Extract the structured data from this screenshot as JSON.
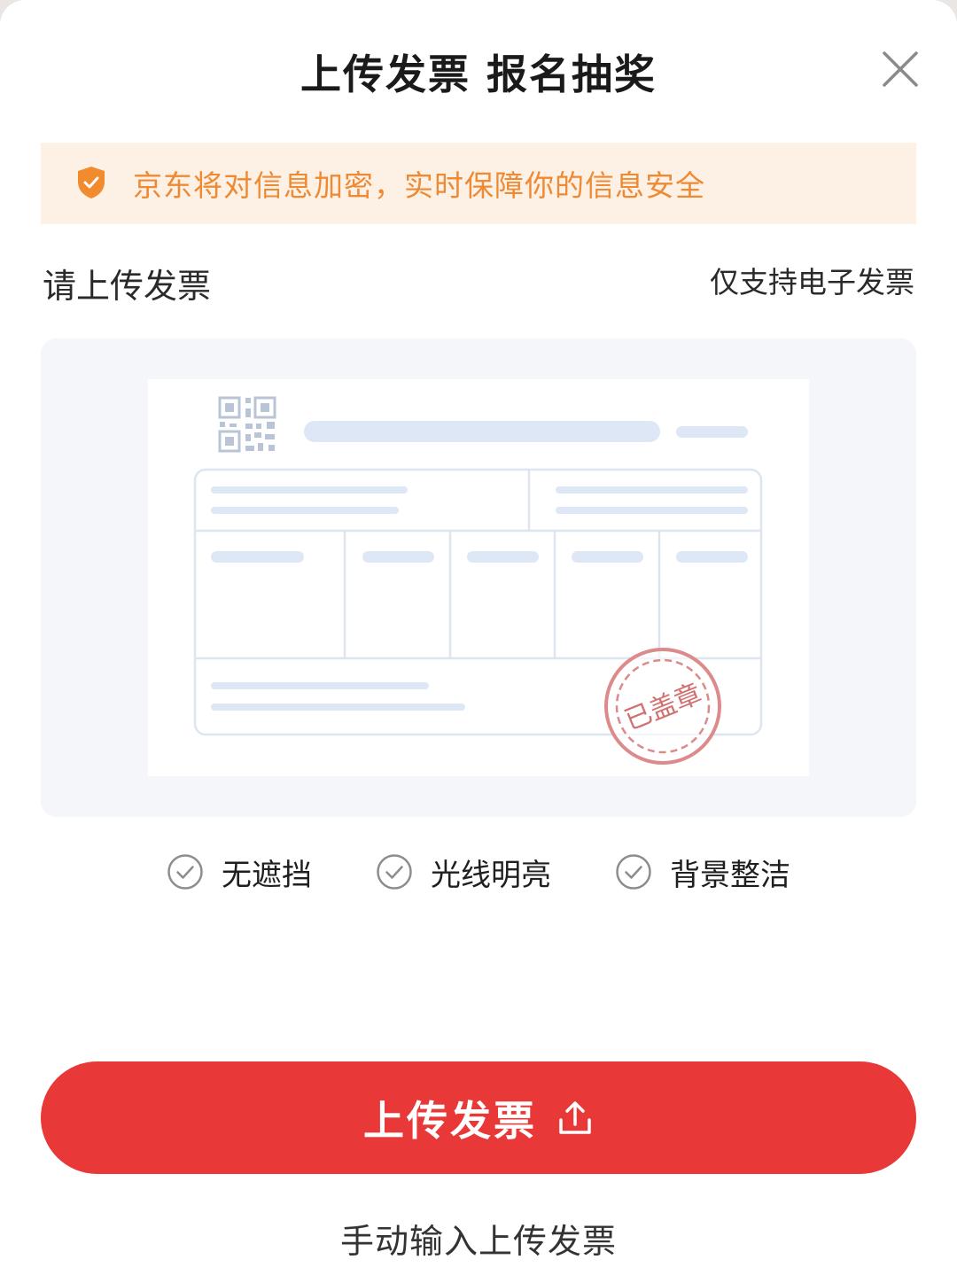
{
  "dialog": {
    "title": "上传发票 报名抽奖"
  },
  "notice": {
    "text": "京东将对信息加密，实时保障你的信息安全",
    "icon": "shield-check-icon",
    "color": "#ee8a33"
  },
  "section": {
    "label": "请上传发票",
    "hint": "仅支持电子发票"
  },
  "sample_invoice": {
    "stamp_text": "已盖章"
  },
  "tips": [
    {
      "label": "无遮挡",
      "icon": "check-circle-icon"
    },
    {
      "label": "光线明亮",
      "icon": "check-circle-icon"
    },
    {
      "label": "背景整洁",
      "icon": "check-circle-icon"
    }
  ],
  "actions": {
    "upload_label": "上传发票",
    "upload_icon": "upload-icon",
    "manual_label": "手动输入上传发票"
  },
  "colors": {
    "accent": "#e93838",
    "notice_bg": "#fdf1e5"
  }
}
